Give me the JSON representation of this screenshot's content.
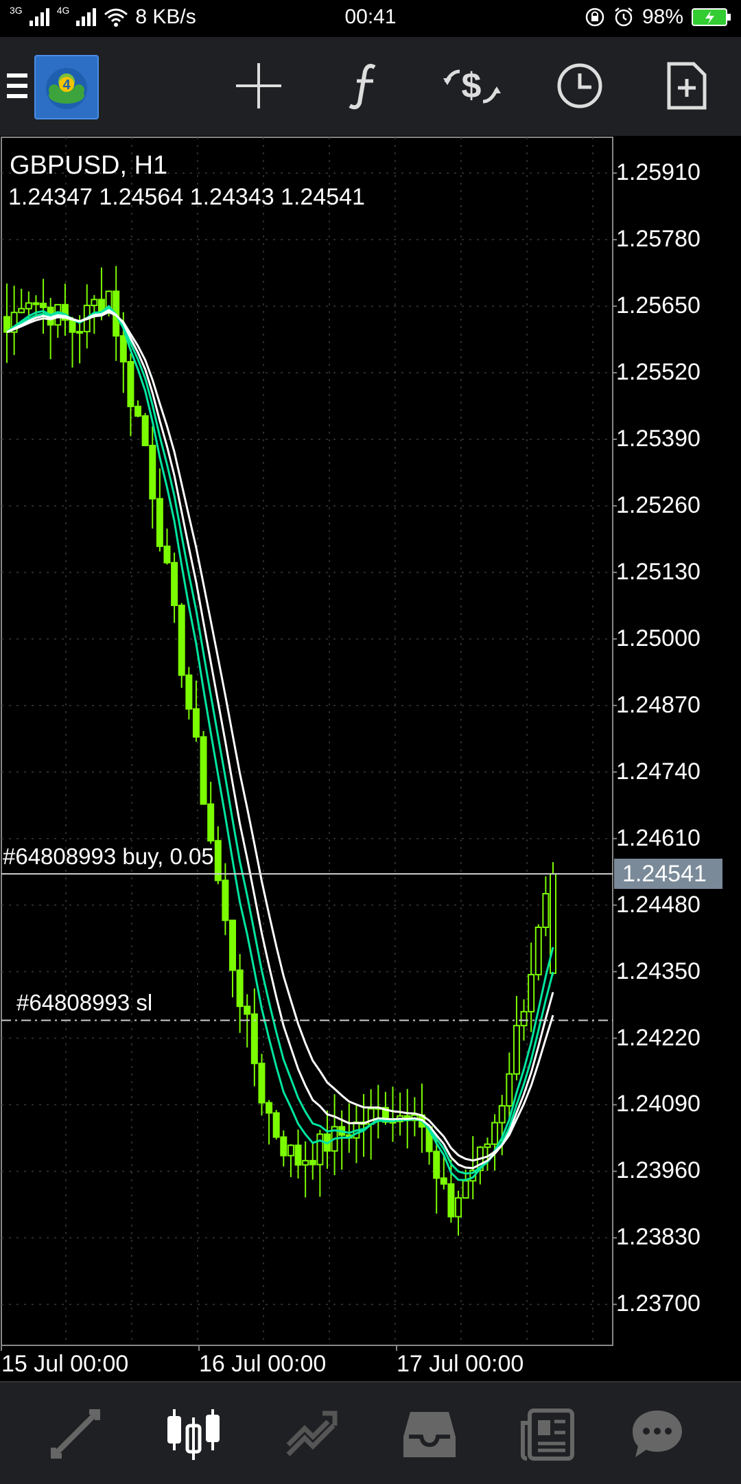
{
  "status_bar": {
    "network_1": "3G",
    "network_2": "4G",
    "speed": "8 KB/s",
    "time": "00:41",
    "battery": "98%"
  },
  "toolbar": {
    "icons": [
      "menu-icon",
      "metatrader-logo",
      "crosshair-icon",
      "indicators-icon",
      "trade-icon",
      "timeframe-icon",
      "new-order-icon"
    ],
    "logo_text": "4"
  },
  "chart": {
    "symbol": "GBPUSD, H1",
    "ohlc": "1.24347 1.24564 1.24343 1.24541",
    "current_price": "1.24541",
    "order_label": "#64808993 buy, 0.05",
    "sl_label": "#64808993 sl",
    "order_price": 1.24541,
    "sl_price": 1.24255,
    "price_axis": [
      "1.25910",
      "1.25780",
      "1.25650",
      "1.25520",
      "1.25390",
      "1.25260",
      "1.25130",
      "1.25000",
      "1.24870",
      "1.24740",
      "1.24610",
      "1.24480",
      "1.24350",
      "1.24220",
      "1.24090",
      "1.23960",
      "1.23830",
      "1.23700"
    ],
    "date_axis": [
      "15 Jul 00:00",
      "16 Jul 00:00",
      "17 Jul 00:00"
    ],
    "colors": {
      "candle": "#7cfc00",
      "ma_fast": "#00e5a0",
      "ma_slow": "#ffffff",
      "grid": "#3a3a3a"
    }
  },
  "chart_data": {
    "type": "candlestick",
    "symbol": "GBPUSD",
    "timeframe": "H1",
    "ylim": [
      1.2362,
      1.2598
    ],
    "close_path": [
      1.256,
      1.2568,
      1.2565,
      1.2563,
      1.256,
      1.2565,
      1.2568,
      1.255,
      1.254,
      1.252,
      1.25,
      1.248,
      1.246,
      1.244,
      1.2425,
      1.241,
      1.2402,
      1.2398,
      1.24,
      1.2402,
      1.2404,
      1.2406,
      1.2408,
      1.2407,
      1.241,
      1.2395,
      1.2388,
      1.2395,
      1.24,
      1.241,
      1.2425,
      1.244,
      1.24541
    ],
    "indicators": [
      "moving-average-fast-1",
      "moving-average-fast-2",
      "moving-average-slow-1",
      "moving-average-slow-2"
    ]
  },
  "bottom_nav": {
    "items": [
      "quotes-icon",
      "chart-icon",
      "trade-icon",
      "history-icon",
      "news-icon",
      "chat-icon"
    ]
  }
}
